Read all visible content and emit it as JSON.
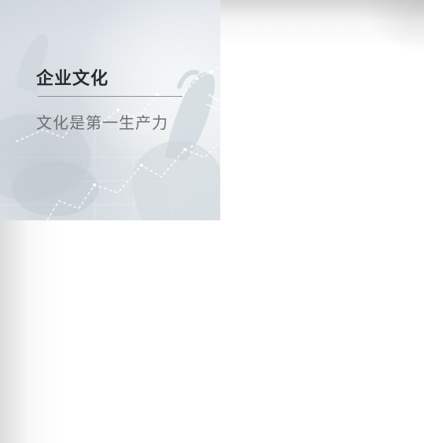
{
  "banner": {
    "title": "企业文化",
    "subtitle": "文化是第一生产力"
  },
  "colors": {
    "title": "#2a2a2a",
    "subtitle": "#6f6f6f",
    "divider": "#8d9398",
    "background": "#ffffff"
  },
  "icons": [
    "hand-with-chart-graphic"
  ]
}
